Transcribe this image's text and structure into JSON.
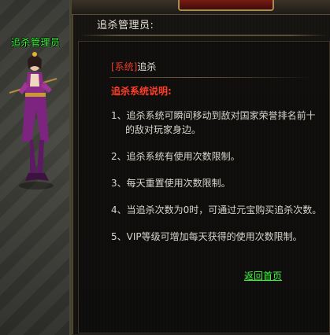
{
  "npc": {
    "name": "追杀管理员"
  },
  "dialog": {
    "header": "追杀管理员:",
    "tag": "[系统]",
    "topic": "追杀",
    "subtitle": "追杀系统说明:",
    "items": [
      "1、追杀系统可瞬间移动到敌对国家荣誉排名前十的敌对玩家身边。",
      "2、追杀系统有使用次数限制。",
      "3、每天重置使用次数限制。",
      "4、当追杀次数为0时，可通过元宝购买追杀次数。",
      "5、VIP等级可增加每天获得的使用次数限制。"
    ],
    "back_label": "返回首页"
  },
  "colors": {
    "npc_name": "#3cff3c",
    "tag": "#e83a2a",
    "subtitle": "#ff3d28",
    "link": "#3cff3c",
    "body_text": "#d9d6ce"
  }
}
